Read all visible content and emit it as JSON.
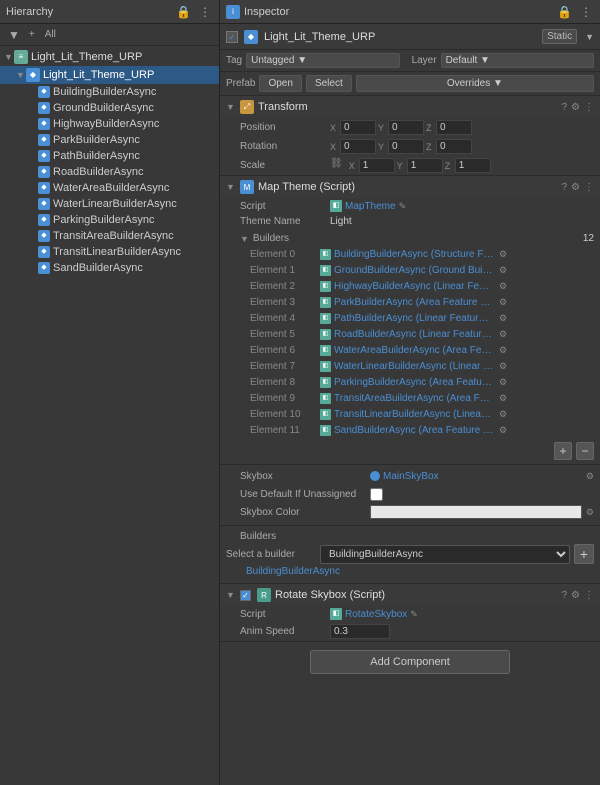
{
  "hierarchy": {
    "title": "Hierarchy",
    "toolbar": {
      "plus_label": "+",
      "all_label": "All"
    },
    "items": [
      {
        "label": "Light_Lit_Theme_URP",
        "level": 0,
        "is_scene": true,
        "has_arrow": true,
        "icon": "scene"
      },
      {
        "label": "Light_Lit_Theme_URP",
        "level": 1,
        "has_arrow": true,
        "icon": "go",
        "selected": true
      },
      {
        "label": "BuildingBuilderAsync",
        "level": 2,
        "has_arrow": false,
        "icon": "go"
      },
      {
        "label": "GroundBuilderAsync",
        "level": 2,
        "has_arrow": false,
        "icon": "go"
      },
      {
        "label": "HighwayBuilderAsync",
        "level": 2,
        "has_arrow": false,
        "icon": "go"
      },
      {
        "label": "ParkBuilderAsync",
        "level": 2,
        "has_arrow": false,
        "icon": "go"
      },
      {
        "label": "PathBuilderAsync",
        "level": 2,
        "has_arrow": false,
        "icon": "go"
      },
      {
        "label": "RoadBuilderAsync",
        "level": 2,
        "has_arrow": false,
        "icon": "go"
      },
      {
        "label": "WaterAreaBuilderAsync",
        "level": 2,
        "has_arrow": false,
        "icon": "go"
      },
      {
        "label": "WaterLinearBuilderAsync",
        "level": 2,
        "has_arrow": false,
        "icon": "go"
      },
      {
        "label": "ParkingBuilderAsync",
        "level": 2,
        "has_arrow": false,
        "icon": "go"
      },
      {
        "label": "TransitAreaBuilderAsync",
        "level": 2,
        "has_arrow": false,
        "icon": "go"
      },
      {
        "label": "TransitLinearBuilderAsync",
        "level": 2,
        "has_arrow": false,
        "icon": "go"
      },
      {
        "label": "SandBuilderAsync",
        "level": 2,
        "has_arrow": false,
        "icon": "go"
      }
    ]
  },
  "inspector": {
    "title": "Inspector",
    "gameobject": {
      "name": "Light_Lit_Theme_URP",
      "tag": "Untagged",
      "layer": "Default",
      "static": "Static",
      "checkbox_checked": true
    },
    "prefab": {
      "prefab_label": "Prefab",
      "open_label": "Open",
      "select_label": "Select",
      "overrides_label": "Overrides"
    },
    "transform": {
      "title": "Transform",
      "position": {
        "label": "Position",
        "x": "0",
        "y": "0",
        "z": "0"
      },
      "rotation": {
        "label": "Rotation",
        "x": "0",
        "y": "0",
        "z": "0"
      },
      "scale": {
        "label": "Scale",
        "x": "1",
        "y": "1",
        "z": "1"
      }
    },
    "map_theme": {
      "title": "Map Theme (Script)",
      "script_label": "Script",
      "script_name": "MapTheme",
      "theme_name_label": "Theme Name",
      "theme_name_val": "Light",
      "builders_label": "Builders",
      "builders_count": "12",
      "elements": [
        {
          "label": "Element 0",
          "value": "BuildingBuilderAsync (Structure Feat..."
        },
        {
          "label": "Element 1",
          "value": "GroundBuilderAsync (Ground Builder ..."
        },
        {
          "label": "Element 2",
          "value": "HighwayBuilderAsync (Linear Feature ..."
        },
        {
          "label": "Element 3",
          "value": "ParkBuilderAsync (Area Feature Build..."
        },
        {
          "label": "Element 4",
          "value": "PathBuilderAsync (Linear Feature Buil..."
        },
        {
          "label": "Element 5",
          "value": "RoadBuilderAsync (Linear Feature Bui..."
        },
        {
          "label": "Element 6",
          "value": "WaterAreaBuilderAsync (Area Feature ..."
        },
        {
          "label": "Element 7",
          "value": "WaterLinearBuilderAsync (Linear Feat..."
        },
        {
          "label": "Element 8",
          "value": "ParkingBuilderAsync (Area Feature B..."
        },
        {
          "label": "Element 9",
          "value": "TransitAreaBuilderAsync (Area Featur..."
        },
        {
          "label": "Element 10",
          "value": "TransitLinearBuilderAsync (Linear Fe..."
        },
        {
          "label": "Element 11",
          "value": "SandBuilderAsync (Area Feature Buil..."
        }
      ],
      "skybox_label": "Skybox",
      "skybox_val": "MainSkyBox",
      "use_default_label": "Use Default If Unassigned",
      "skybox_color_label": "Skybox Color",
      "builders_select_label": "Select a builder",
      "builders_select_val": "BuildingBuilderAsync",
      "building_link": "BuildingBuilderAsync"
    },
    "rotate_skybox": {
      "title": "Rotate Skybox (Script)",
      "script_label": "Script",
      "script_name": "RotateSkybox",
      "anim_speed_label": "Anim Speed",
      "anim_speed_val": "0.3"
    },
    "add_component_label": "Add Component"
  }
}
